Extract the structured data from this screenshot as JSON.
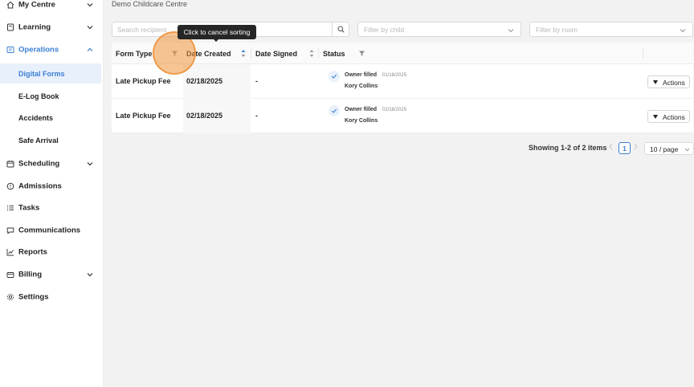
{
  "sidebar": {
    "items": [
      {
        "label": "My Centre",
        "icon": "home-icon",
        "has_chevron": true
      },
      {
        "label": "Learning",
        "icon": "book-icon",
        "has_chevron": true
      },
      {
        "label": "Operations",
        "icon": "operations-icon",
        "has_chevron": true,
        "expanded": true
      },
      {
        "label": "Scheduling",
        "icon": "calendar-icon",
        "has_chevron": true
      },
      {
        "label": "Admissions",
        "icon": "admissions-icon",
        "has_chevron": false
      },
      {
        "label": "Tasks",
        "icon": "tasks-icon",
        "has_chevron": false
      },
      {
        "label": "Communications",
        "icon": "chat-icon",
        "has_chevron": false
      },
      {
        "label": "Reports",
        "icon": "chart-icon",
        "has_chevron": false
      },
      {
        "label": "Billing",
        "icon": "wallet-icon",
        "has_chevron": true
      },
      {
        "label": "Settings",
        "icon": "gear-icon",
        "has_chevron": false
      }
    ],
    "operations_subitems": [
      {
        "label": "Digital Forms",
        "selected": true
      },
      {
        "label": "E-Log Book",
        "selected": false
      },
      {
        "label": "Accidents",
        "selected": false
      },
      {
        "label": "Safe Arrival",
        "selected": false
      }
    ]
  },
  "breadcrumb": "Demo Childcare Centre",
  "filters": {
    "search_placeholder": "Search recipient",
    "child_placeholder": "Filter by child",
    "room_placeholder": "Filter by room"
  },
  "table": {
    "columns": [
      "Form Type",
      "Date Created",
      "Date Signed",
      "Status"
    ],
    "rows": [
      {
        "form_type": "Late Pickup Fee",
        "date_created": "02/18/2025",
        "date_signed": "-",
        "status": "Owner filled",
        "status_date": "01/18/2025",
        "signer": "Kory Collins",
        "action": "Actions"
      },
      {
        "form_type": "Late Pickup Fee",
        "date_created": "02/18/2025",
        "date_signed": "-",
        "status": "Owner filled",
        "status_date": "02/18/2025",
        "signer": "Kory Collins",
        "action": "Actions"
      }
    ]
  },
  "tooltip": "Click to cancel sorting",
  "pagination": {
    "summary": "Showing 1-2 of 2 items",
    "current_page": "1",
    "page_size": "10 / page"
  },
  "colors": {
    "accent": "#3b7fd1",
    "click_highlight": "#f0963c"
  }
}
